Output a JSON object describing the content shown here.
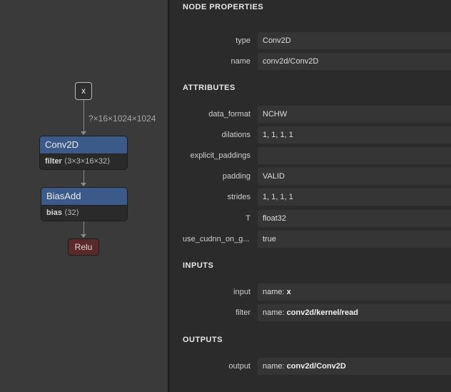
{
  "graph": {
    "input_node": "x",
    "edge_label": "?×16×1024×1024",
    "conv_node": {
      "title": "Conv2D",
      "attr_name": "filter",
      "attr_value": "⟨3×3×16×32⟩"
    },
    "bias_node": {
      "title": "BiasAdd",
      "attr_name": "bias",
      "attr_value": "⟨32⟩"
    },
    "relu_node": "Relu"
  },
  "properties": {
    "node_properties_title": "NODE PROPERTIES",
    "type": {
      "key": "type",
      "value": "Conv2D"
    },
    "name": {
      "key": "name",
      "value": "conv2d/Conv2D"
    },
    "attributes_title": "ATTRIBUTES",
    "attributes": [
      {
        "key": "data_format",
        "value": "NCHW"
      },
      {
        "key": "dilations",
        "value": "1, 1, 1, 1"
      },
      {
        "key": "explicit_paddings",
        "value": ""
      },
      {
        "key": "padding",
        "value": "VALID"
      },
      {
        "key": "strides",
        "value": "1, 1, 1, 1"
      },
      {
        "key": "T",
        "value": "float32"
      },
      {
        "key": "use_cudnn_on_g...",
        "value": "true"
      }
    ],
    "inputs_title": "INPUTS",
    "inputs": [
      {
        "key": "input",
        "prefix": "name: ",
        "value": "x"
      },
      {
        "key": "filter",
        "prefix": "name: ",
        "value": "conv2d/kernel/read"
      }
    ],
    "outputs_title": "OUTPUTS",
    "outputs": [
      {
        "key": "output",
        "prefix": "name: ",
        "value": "conv2d/Conv2D"
      }
    ]
  }
}
